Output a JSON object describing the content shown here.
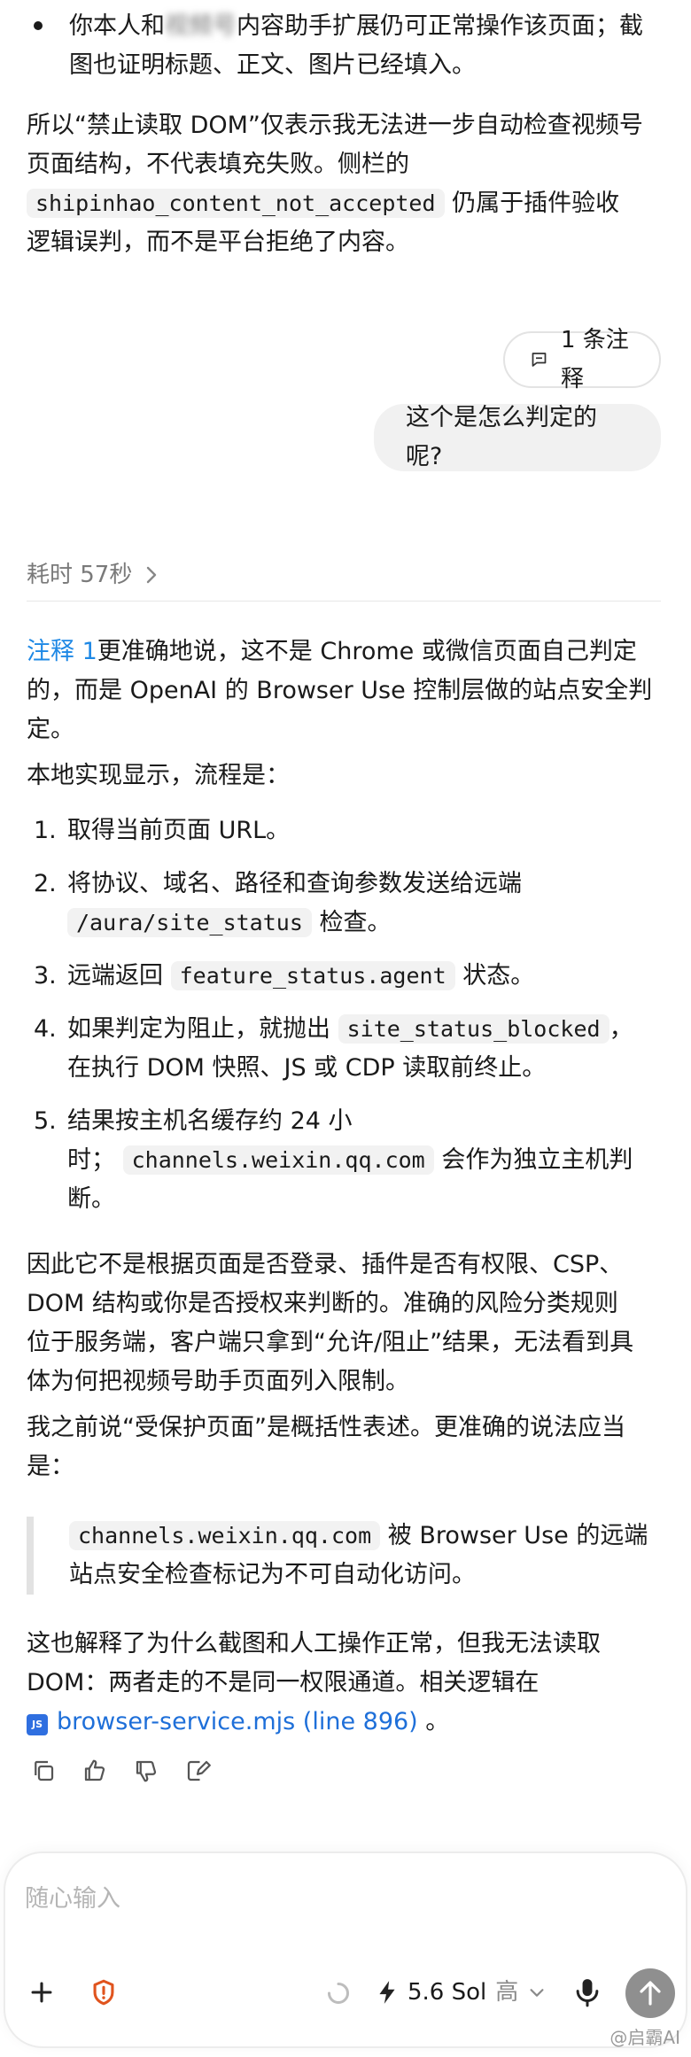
{
  "top_bullet": {
    "line1": "你本人和",
    "blurred": "视频号",
    "line1_rest": "内容助手扩展仍可正常操作该页面；截",
    "line2": "图也证明标题、正文、图片已经填入。"
  },
  "para1": {
    "l1": "所以“禁止读取 DOM”仅表示我无法进一步自动检查视频号",
    "l2": "页面结构，不代表填充失败。侧栏的",
    "code": "shipinhao_content_not_accepted",
    "l3_rest": "仍属于插件验收",
    "l4": "逻辑误判，而不是平台拒绝了内容。"
  },
  "annotation_pill": "1 条注释",
  "user_message": "这个是怎么判定的呢?",
  "elapsed": "耗时 57秒",
  "answer": {
    "note_label": "注释 1",
    "intro_l1": "更准确地说，这不是 Chrome 或微信页面自己判定",
    "intro_l2": "的，而是 OpenAI 的 Browser Use 控制层做的站点安全判",
    "intro_l3": "定。",
    "flow_intro": "本地实现显示，流程是：",
    "steps": [
      {
        "n": "1.",
        "l1": "取得当前页面 URL。"
      },
      {
        "n": "2.",
        "l1": "将协议、域名、路径和查询参数发送给远端",
        "code": "/aura/site_status",
        "after": "检查。"
      },
      {
        "n": "3.",
        "before": "远端返回",
        "code": "feature_status.agent",
        "after": "状态。"
      },
      {
        "n": "4.",
        "before": "如果判定为阻止，就抛出",
        "code": "site_status_blocked",
        "after": "，",
        "l2": "在执行 DOM 快照、JS 或 CDP 读取前终止。"
      },
      {
        "n": "5.",
        "l1": "结果按主机名缓存约 24 小",
        "before2": "时；",
        "code": "channels.weixin.qq.com",
        "after2": "会作为独立主机判",
        "l3": "断。"
      }
    ],
    "para2_l1": "因此它不是根据页面是否登录、插件是否有权限、CSP、",
    "para2_l2": "DOM 结构或你是否授权来判断的。准确的风险分类规则",
    "para2_l3": "位于服务端，客户端只拿到“允许/阻止”结果，无法看到具",
    "para2_l4": "体为何把视频号助手页面列入限制。",
    "para3_l1": "我之前说“受保护页面”是概括性表述。更准确的说法应当",
    "para3_l2": "是：",
    "quote_code": "channels.weixin.qq.com",
    "quote_l1_rest": "被 Browser Use 的远端",
    "quote_l2": "站点安全检查标记为不可自动化访问。",
    "para4_l1": "这也解释了为什么截图和人工操作正常，但我无法读取",
    "para4_l2": "DOM：两者走的不是同一权限通道。相关逻辑在",
    "file_badge": "JS",
    "file_link": "browser-service.mjs (line 896)",
    "file_after": "。"
  },
  "composer": {
    "placeholder": "随心输入",
    "model": "5.6 Sol",
    "effort": "高"
  },
  "watermark": "@启霸AI"
}
